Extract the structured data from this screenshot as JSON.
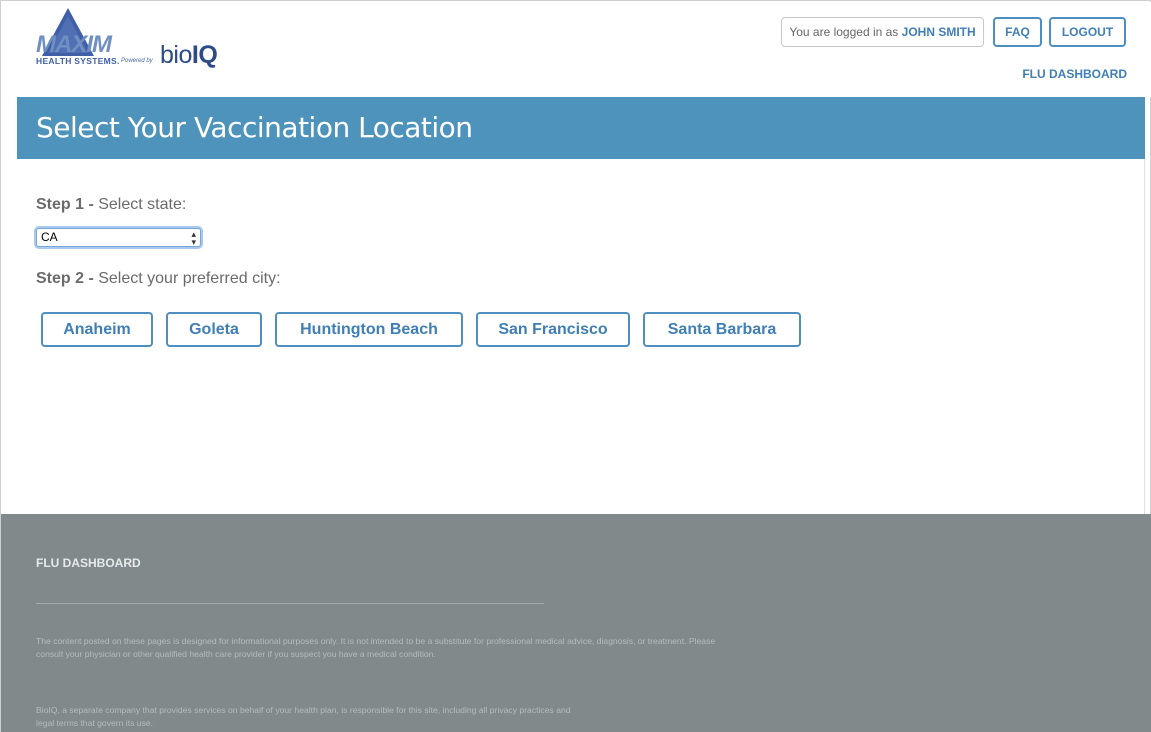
{
  "header": {
    "logo": {
      "brand": "MAXIM",
      "tagline": "HEALTH SYSTEMS.",
      "powered_by": "Powered by",
      "partner_prefix": "bio",
      "partner_suffix": "IQ"
    },
    "login_prefix": "You are logged in as",
    "user_name": "JOHN SMITH",
    "faq_label": "FAQ",
    "logout_label": "LOGOUT",
    "dashboard_link": "FLU DASHBOARD"
  },
  "banner": {
    "title": "Select Your Vaccination Location"
  },
  "steps": {
    "step1": {
      "number": "Step 1",
      "separator": " - ",
      "label": "Select state:"
    },
    "step2": {
      "number": "Step 2",
      "separator": " - ",
      "label": "Select your preferred city:"
    }
  },
  "state_select": {
    "value": "CA"
  },
  "cities": [
    "Anaheim",
    "Goleta",
    "Huntington Beach",
    "San Francisco",
    "Santa Barbara"
  ],
  "footer": {
    "link": "FLU DASHBOARD",
    "disclaimer1": "The content posted on these pages is designed for informational purposes only. It is not intended to be a substitute for professional medical advice, diagnosis, or treatment. Please consult your physician or other qualified health care provider if you suspect you have a medical condition.",
    "disclaimer2": "BioIQ, a separate company that provides services on behalf of your health plan, is responsible for this site, including all privacy practices and legal terms that govern its use."
  },
  "colors": {
    "accent": "#4e93bb",
    "link": "#3f7fb5",
    "footer_bg": "#808a8b"
  },
  "icons": {
    "logo_mark": "triangle-logo-icon",
    "select_arrows": "select-arrows-icon"
  }
}
